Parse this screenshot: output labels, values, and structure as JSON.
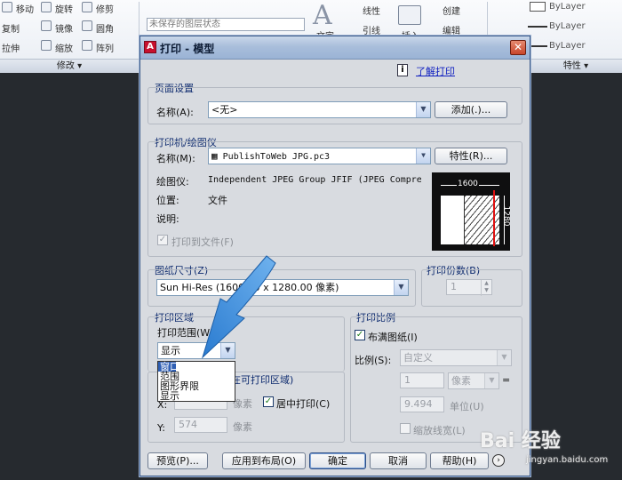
{
  "ribbon": {
    "left_items": [
      "移动",
      "旋转",
      "修剪",
      "复制",
      "镜像",
      "圆角",
      "拉伸",
      "缩放",
      "阵列"
    ],
    "layer_combo": "未保存的图层状态",
    "text_label": "文字",
    "mid_items": [
      "线性",
      "引线",
      "插入",
      "创建",
      "编辑"
    ],
    "group_modify": "修改",
    "group_properties": "特性",
    "bylayer": [
      "ByLayer",
      "ByLayer",
      "ByLayer"
    ]
  },
  "dialog": {
    "title": "打印 - 模型",
    "help_link": "了解打印",
    "page_setup": {
      "label": "页面设置",
      "name_label": "名称(A):",
      "name_value": "<无>",
      "add_button": "添加(.)..."
    },
    "printer": {
      "label": "打印机/绘图仪",
      "name_label": "名称(M):",
      "name_value": "PublishToWeb JPG.pc3",
      "properties_button": "特性(R)...",
      "plotter_label": "绘图仪:",
      "plotter_value": "Independent JPEG Group JFIF (JPEG Compressi...",
      "location_label": "位置:",
      "location_value": "文件",
      "description_label": "说明:",
      "print_to_file": "打印到文件(F)",
      "preview_width": "1600",
      "preview_height": "1280"
    },
    "paper_size": {
      "label": "图纸尺寸(Z)",
      "value": "Sun Hi-Res (1600.00 x 1280.00 像素)"
    },
    "copies": {
      "label": "打印份数(B)",
      "value": "1"
    },
    "plot_area": {
      "label": "打印区域",
      "range_label": "打印范围(W):",
      "range_value": "显示",
      "options": [
        "窗口",
        "范围",
        "图形界限",
        "显示"
      ]
    },
    "plot_offset": {
      "label_partial": "在可打印区域)",
      "x_label": "X:",
      "x_unit": "像素",
      "y_label": "Y:",
      "y_value": "574",
      "y_unit": "像素",
      "center_plot": "居中打印(C)"
    },
    "plot_scale": {
      "label": "打印比例",
      "fit_paper": "布满图纸(I)",
      "scale_label": "比例(S):",
      "scale_value": "自定义",
      "value1": "1",
      "unit1": "像素",
      "equals": "=",
      "value2": "9.494",
      "unit2": "单位(U)",
      "scale_lineweights": "缩放线宽(L)"
    },
    "buttons": {
      "preview": "预览(P)...",
      "apply_layout": "应用到布局(O)",
      "ok": "确定",
      "cancel": "取消",
      "help": "帮助(H)"
    }
  },
  "watermark": {
    "text": "Bai 经验",
    "url": "jingyan.baidu.com"
  }
}
